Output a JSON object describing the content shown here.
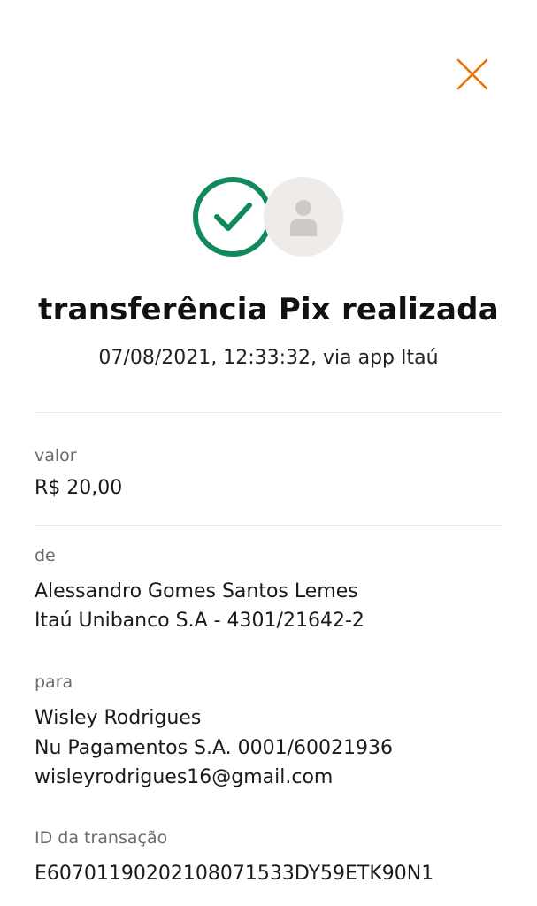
{
  "header": {
    "close_icon": "close-icon",
    "accent_color": "#ec7000"
  },
  "status": {
    "success_icon": "check-circle-icon",
    "success_color": "#108a5a",
    "avatar_icon": "person-placeholder-icon",
    "title": "transferência Pix realizada",
    "subtitle": "07/08/2021, 12:33:32, via app Itaú"
  },
  "details": {
    "amount": {
      "label": "valor",
      "value": "R$ 20,00"
    },
    "from": {
      "label": "de",
      "name": "Alessandro Gomes Santos Lemes",
      "bank": "Itaú Unibanco S.A - 4301/21642-2"
    },
    "to": {
      "label": "para",
      "name": "Wisley Rodrigues",
      "bank": "Nu Pagamentos S.A. 0001/60021936",
      "key": "wisleyrodrigues16@gmail.com"
    },
    "transaction": {
      "label": "ID da transação",
      "id": "E60701190202108071533DY59ETK90N1"
    }
  }
}
